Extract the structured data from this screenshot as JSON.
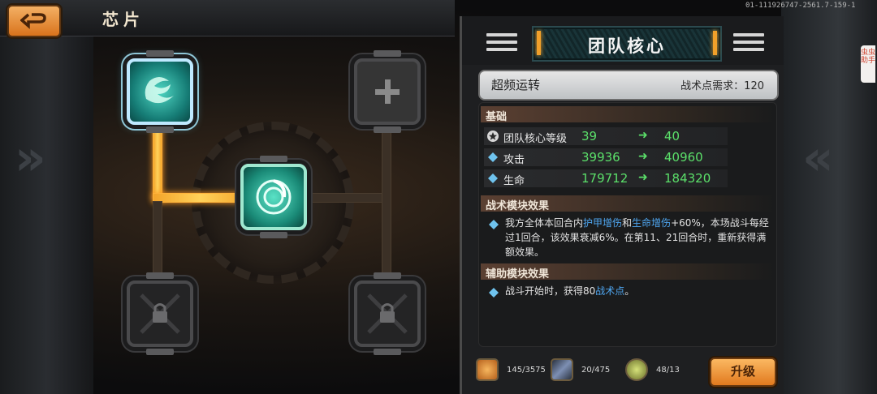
{
  "header": {
    "title": "芯片",
    "build_id": "01-111926747-2561.7-159-1"
  },
  "helper_tab": {
    "label": "虫虫助手"
  },
  "icons": {
    "back": "back-arrow-icon",
    "menu": "hamburger-icon",
    "star": "star-icon",
    "diamond": "diamond-bullet-icon",
    "lock": "lock-icon",
    "plus": "plus-icon"
  },
  "colors": {
    "accent_orange": "#e8891f",
    "stat_green": "#5be06a",
    "highlight_blue": "#4fa6f0",
    "hazard_yellow": "#d0a21a"
  },
  "chip_slots": [
    {
      "name": "top-left",
      "state": "equipped"
    },
    {
      "name": "top-right",
      "state": "empty"
    },
    {
      "name": "center",
      "state": "core"
    },
    {
      "name": "bottom-left",
      "state": "locked"
    },
    {
      "name": "bottom-right",
      "state": "locked"
    }
  ],
  "panel": {
    "title": "团队核心",
    "skill_name": "超频运转",
    "skill_requirement": "战术点需求：120",
    "sections": {
      "base": "基础",
      "tactical": "战术模块效果",
      "assist": "辅助模块效果"
    },
    "stats": [
      {
        "label": "团队核心等级",
        "from": "39",
        "to": "40",
        "icon": "star-icon"
      },
      {
        "label": "攻击",
        "from": "39936",
        "to": "40960",
        "icon": "diamond-bullet-icon"
      },
      {
        "label": "生命",
        "from": "179712",
        "to": "184320",
        "icon": "diamond-bullet-icon"
      }
    ],
    "arrow": "➜",
    "tactical_desc": {
      "p1": "我方全体本回合内",
      "h1": "护甲增伤",
      "p2": "和",
      "h2": "生命增伤",
      "p3": "+60%，本场战斗每经过1回合，该效果衰减6%。在第11、21回合时，重新获得满额效果。"
    },
    "assist_desc": {
      "p1": "战斗开始时，获得80",
      "h1": "战术点",
      "p2": "。"
    }
  },
  "resources": [
    {
      "amount": "145/3575",
      "icon": "orange-material-icon"
    },
    {
      "amount": "20/475",
      "icon": "blue-chip-material-icon"
    },
    {
      "amount": "48/13",
      "icon": "gold-gear-icon"
    }
  ],
  "upgrade_button": {
    "label": "升级"
  }
}
